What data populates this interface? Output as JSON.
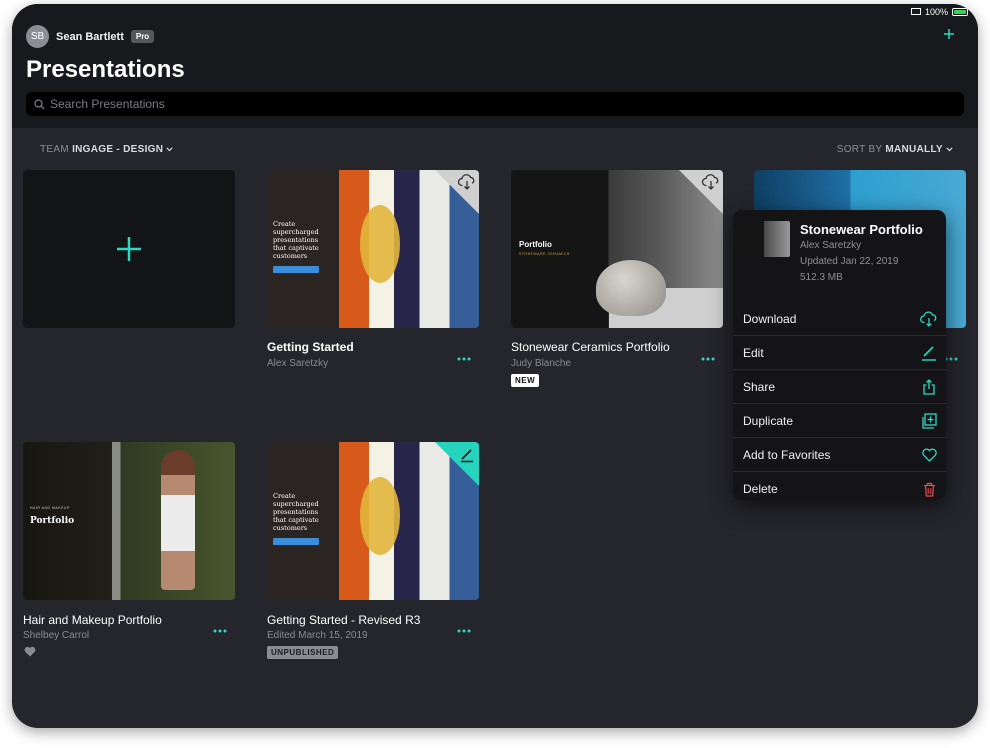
{
  "status": {
    "battery": "100%"
  },
  "user": {
    "initials": "SB",
    "name": "Sean Bartlett",
    "plan": "Pro"
  },
  "header": {
    "title": "Presentations",
    "search_placeholder": "Search Presentations",
    "add_icon": "plus-icon"
  },
  "filters": {
    "team_prefix": "TEAM",
    "team_value": "INGAGE - DESIGN",
    "sort_prefix": "SORT BY",
    "sort_value": "MANUALLY"
  },
  "cards": [
    {
      "title": "Getting Started",
      "subtitle": "Alex Saretzky",
      "thumb_headline": "Create supercharged presentations that captivate customers",
      "corner_icon": "cloud-download-icon"
    },
    {
      "title": "Stonewear Ceramics Portfolio",
      "subtitle": "Judy Blanche",
      "badge": "NEW",
      "thumb_title": "Portfolio",
      "thumb_subtitle": "STONEWARE CERAMICS",
      "corner_icon": "cloud-download-icon"
    },
    {
      "title": "Hair and Makeup Portfolio",
      "subtitle": "Shelbey Carrol",
      "favorite": true,
      "thumb_small": "HAIR AND MAKEUP",
      "thumb_title": "Portfolio"
    },
    {
      "title": "Getting Started - Revised R3",
      "subtitle": "Edited March 15, 2019",
      "badge": "UNPUBLISHED",
      "thumb_headline": "Create supercharged presentations that captivate customers",
      "corner_icon": "pencil-icon"
    }
  ],
  "popover": {
    "title": "Stonewear Portfolio",
    "author": "Alex Saretzky",
    "updated": "Updated Jan 22, 2019",
    "size": "512.3 MB",
    "items": [
      {
        "label": "Download",
        "icon": "cloud-download-icon"
      },
      {
        "label": "Edit",
        "icon": "pencil-icon"
      },
      {
        "label": "Share",
        "icon": "share-icon"
      },
      {
        "label": "Duplicate",
        "icon": "duplicate-icon"
      },
      {
        "label": "Add to Favorites",
        "icon": "heart-icon"
      },
      {
        "label": "Delete",
        "icon": "trash-icon"
      }
    ]
  },
  "colors": {
    "accent": "#2fd8c4",
    "danger": "#e5484d",
    "background": "#25262b",
    "header": "#18191c"
  }
}
